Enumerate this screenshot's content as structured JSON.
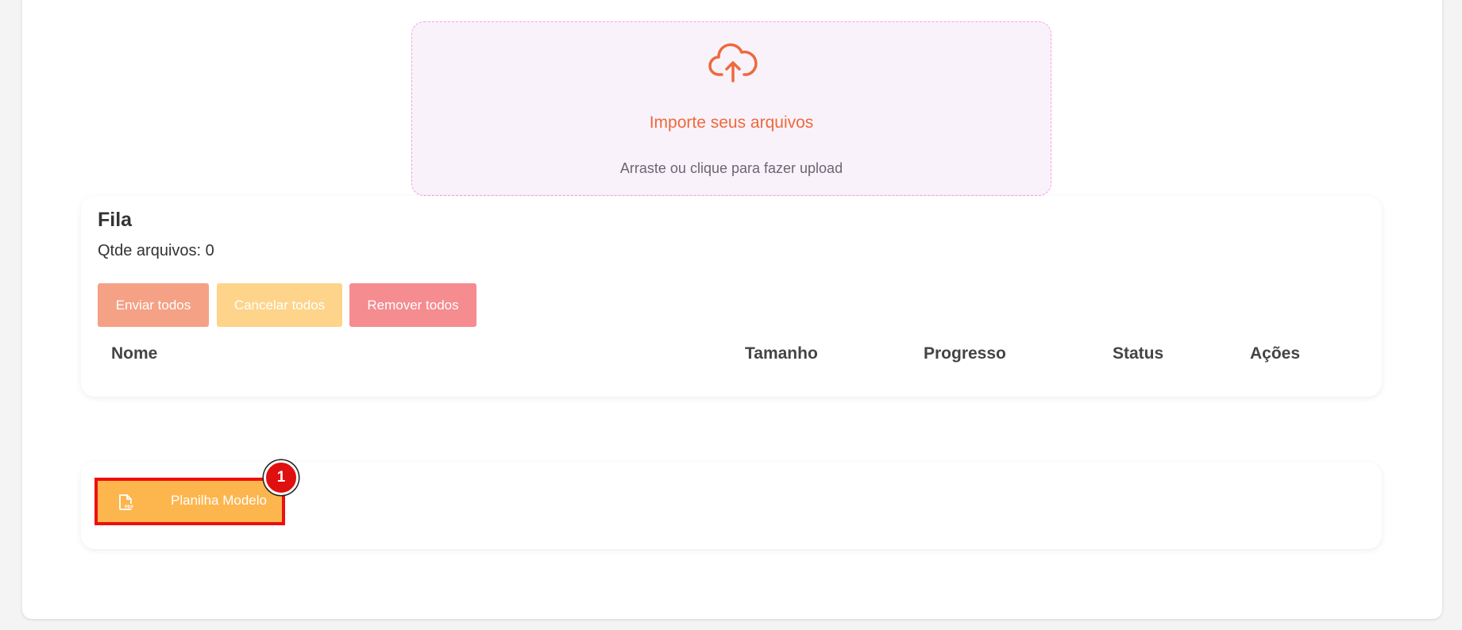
{
  "dropzone": {
    "icon": "cloud-upload-icon",
    "title": "Importe seus arquivos",
    "subtitle": "Arraste ou clique para fazer upload"
  },
  "queue": {
    "title": "Fila",
    "count_text": "Qtde arquivos: 0",
    "buttons": {
      "send_all": "Enviar todos",
      "cancel_all": "Cancelar todos",
      "remove_all": "Remover todos"
    },
    "columns": [
      "Nome",
      "Tamanho",
      "Progresso",
      "Status",
      "Ações"
    ],
    "rows": []
  },
  "download": {
    "icon": "pdf-file-icon",
    "label": "Planilha Modelo"
  },
  "annotation": {
    "marker_label": "1"
  },
  "colors": {
    "accent_orange": "#ec6a3c",
    "send_button": "#f5a185",
    "cancel_button": "#fdd48a",
    "remove_button": "#f58c90",
    "download_button": "#fdb54d",
    "highlight_border": "#ee0f0f",
    "dropzone_border": "#f5a0e0",
    "dropzone_bg": "#faf2fa"
  }
}
